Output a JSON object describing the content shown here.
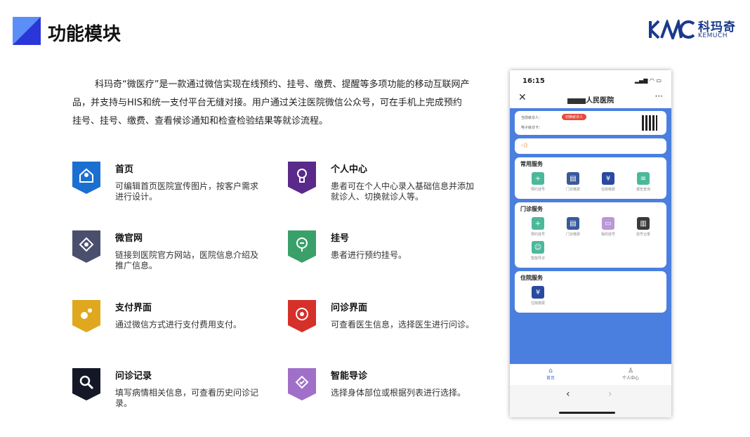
{
  "header": {
    "title": "功能模块"
  },
  "logo": {
    "cn": "科玛奇",
    "en": "KEMUCH"
  },
  "intro": "科玛奇“微医疗”是一款通过微信实现在线预约、挂号、缴费、提醒等多项功能的移动互联网产品，并支持与HIS和统一支付平台无缝对接。用户通过关注医院微信公众号，可在手机上完成预约挂号、挂号、缴费、查看候诊通知和检查检验结果等就诊流程。",
  "features": [
    {
      "title": "首页",
      "desc": "可编辑首页医院宣传图片，按客户需求进行设计。",
      "color": "#1b6fd0",
      "icon": "home-icon"
    },
    {
      "title": "个人中心",
      "desc": "患者可在个人中心录入基础信息并添加就诊人、切换就诊人等。",
      "color": "#5a2a8a",
      "icon": "user-icon"
    },
    {
      "title": "微官网",
      "desc": "链接到医院官方网站，医院信息介绍及推广信息。",
      "color": "#4a4f6e",
      "icon": "website-icon"
    },
    {
      "title": "挂号",
      "desc": "患者进行预约挂号。",
      "color": "#3aa06a",
      "icon": "register-icon"
    },
    {
      "title": "支付界面",
      "desc": "通过微信方式进行支付费用支付。",
      "color": "#e0a81e",
      "icon": "payment-icon"
    },
    {
      "title": "问诊界面",
      "desc": "可查看医生信息，选择医生进行问诊。",
      "color": "#d6302a",
      "icon": "consult-icon"
    },
    {
      "title": "问诊记录",
      "desc": "填写病情相关信息，可查看历史问诊记录。",
      "color": "#141826",
      "icon": "search-icon"
    },
    {
      "title": "智能导诊",
      "desc": "选择身体部位或根据列表进行选择。",
      "color": "#a070c8",
      "icon": "guide-icon"
    }
  ],
  "phone": {
    "time": "16:15",
    "hospital": "人民医院",
    "patient_label": "当前就诊人：",
    "card_label": "电子就诊卡：",
    "switch_btn": "切换就诊人",
    "notice": "◁)",
    "sections": [
      {
        "title": "常用服务",
        "items": [
          {
            "label": "预约挂号",
            "icon": "clinic-icon",
            "color": "#4cb89a"
          },
          {
            "label": "门诊缴费",
            "icon": "bill-icon",
            "color": "#3a5a9a"
          },
          {
            "label": "住院缴费",
            "icon": "yuan-bag-icon",
            "color": "#2a4aa0"
          },
          {
            "label": "报告查询",
            "icon": "report-icon",
            "color": "#4cb89a"
          }
        ]
      },
      {
        "title": "门诊服务",
        "items": [
          {
            "label": "预约挂号",
            "icon": "clinic-icon",
            "color": "#4cb89a"
          },
          {
            "label": "门诊缴费",
            "icon": "bill-icon",
            "color": "#3a5a9a"
          },
          {
            "label": "我的挂号",
            "icon": "my-register-icon",
            "color": "#b898d8"
          },
          {
            "label": "挂号记录",
            "icon": "record-icon",
            "color": "#3a3a3a"
          },
          {
            "label": "智能导诊",
            "icon": "doctor-icon",
            "color": "#4cb89a"
          }
        ]
      },
      {
        "title": "住院服务",
        "items": [
          {
            "label": "住院缴费",
            "icon": "yuan-bag-icon",
            "color": "#2a4aa0"
          }
        ]
      }
    ],
    "tabs": [
      {
        "label": "首页",
        "icon": "home-tab-icon"
      },
      {
        "label": "个人中心",
        "icon": "user-tab-icon"
      }
    ]
  }
}
